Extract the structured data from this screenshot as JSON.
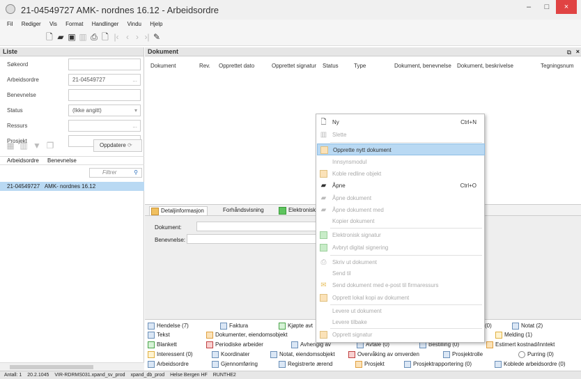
{
  "window": {
    "title": "21-04549727 AMK- nordnes 16.12 - Arbeidsordre",
    "min_label": "–",
    "max_label": "□",
    "close_label": "×"
  },
  "menu": [
    "Fil",
    "Rediger",
    "Vis",
    "Format",
    "Handlinger",
    "Vindu",
    "Hjelp"
  ],
  "toolbar_icons": [
    "new-document-icon",
    "open-folder-icon",
    "save-icon",
    "delete-icon",
    "print-icon",
    "preview-icon",
    "first-record-icon",
    "prev-record-icon",
    "next-record-icon",
    "last-record-icon",
    "attachment-icon"
  ],
  "list": {
    "header": "Liste",
    "fields": [
      {
        "label": "Søkeord",
        "value": ""
      },
      {
        "label": "Arbeidsordre",
        "value": "21-04549727"
      },
      {
        "label": "Benevnelse",
        "value": ""
      },
      {
        "label": "Status",
        "value": "(Ikke angitt)"
      },
      {
        "label": "Ressurs",
        "value": ""
      },
      {
        "label": "Prosjekt",
        "value": ""
      }
    ],
    "update_button": "Oppdatere",
    "columns": [
      "Arbeidsordre",
      "Benevnelse"
    ],
    "filter_placeholder": "Filtrer",
    "rows": [
      {
        "id": "21-04549727",
        "name": "AMK- nordnes 16.12"
      }
    ]
  },
  "document": {
    "header": "Dokument",
    "columns": [
      "Dokument",
      "Rev.",
      "Opprettet dato",
      "Opprettet signatur",
      "Status",
      "Type",
      "Dokument, benevnelse",
      "Dokument, beskrivelse",
      "Tegningsnum"
    ]
  },
  "details": {
    "tabs": [
      "Detaljinformasjon",
      "Forhåndsvisning",
      "Elektronisk"
    ],
    "labels": [
      "Dokument:",
      "Benevnelse:"
    ]
  },
  "links": [
    {
      "label": "Hendelse (7)"
    },
    {
      "label": "Faktura"
    },
    {
      "label": "Kjøpte avt"
    },
    {
      "label": "(0)"
    },
    {
      "label": "Notat (2)"
    },
    {
      "label": "Tekst"
    },
    {
      "label": "Dokumenter, eiendomsobjekt"
    },
    {
      "label": "Melding (1)"
    },
    {
      "label": "Blankett"
    },
    {
      "label": "Periodiske arbeider"
    },
    {
      "label": "Avhengig av"
    },
    {
      "label": "Avtale (0)"
    },
    {
      "label": "Bestilling (0)"
    },
    {
      "label": "Estimert kostnad/inntekt"
    },
    {
      "label": "Interessent (0)"
    },
    {
      "label": "Koordinater"
    },
    {
      "label": "Notat, eiendomsobjekt"
    },
    {
      "label": "Overvåking av omverden"
    },
    {
      "label": "Prosjektrolle"
    },
    {
      "label": "Purring (0)"
    },
    {
      "label": "Arbeidsordre"
    },
    {
      "label": "Gjennomføring"
    },
    {
      "label": "Registrerte ærend"
    },
    {
      "label": "Prosjekt"
    },
    {
      "label": "Prosjektrapportering (0)"
    },
    {
      "label": "Koblede arbeidsordre (0)"
    }
  ],
  "context_menu": [
    {
      "label": "Ny",
      "shortcut": "Ctrl+N",
      "icon": "new-document-icon",
      "enabled": true
    },
    {
      "label": "Slette",
      "icon": "delete-icon",
      "enabled": false
    },
    {
      "label": "Opprette nytt dokument",
      "icon": "document-icon",
      "enabled": true,
      "highlighted": true
    },
    {
      "label": "Innsynsmodul",
      "enabled": false
    },
    {
      "label": "Koble redline objekt",
      "icon": "redline-icon",
      "enabled": false
    },
    {
      "label": "Åpne",
      "shortcut": "Ctrl+O",
      "icon": "open-folder-icon",
      "enabled": true
    },
    {
      "label": "Åpne dokument",
      "icon": "open-folder-icon",
      "enabled": false
    },
    {
      "label": "Åpne dokument med",
      "icon": "open-folder-icon",
      "enabled": false
    },
    {
      "label": "Kopier dokument",
      "enabled": false
    },
    {
      "label": "Elektronisk signatur",
      "icon": "signature-icon",
      "enabled": false
    },
    {
      "label": "Avbryt digital signering",
      "icon": "signature-icon",
      "enabled": false
    },
    {
      "label": "Skriv ut dokument",
      "icon": "print-icon",
      "enabled": false
    },
    {
      "label": "Send til",
      "enabled": false
    },
    {
      "label": "Send dokument med e-post til firmaressurs",
      "icon": "mail-icon",
      "enabled": false
    },
    {
      "label": "Opprett lokal kopi av dokument",
      "icon": "document-icon",
      "enabled": false
    },
    {
      "label": "Levere ut dokument",
      "enabled": false
    },
    {
      "label": "Levere tilbake",
      "enabled": false
    },
    {
      "label": "Opprett signatur",
      "icon": "document-icon",
      "enabled": false
    }
  ],
  "statusbar": [
    "Antall: 1",
    "20.2.1045",
    "VIR-RDRMS031.xpand_sv_prod",
    "xpand_db_prod",
    "Helse Bergen HF",
    "RUNTHE2"
  ]
}
